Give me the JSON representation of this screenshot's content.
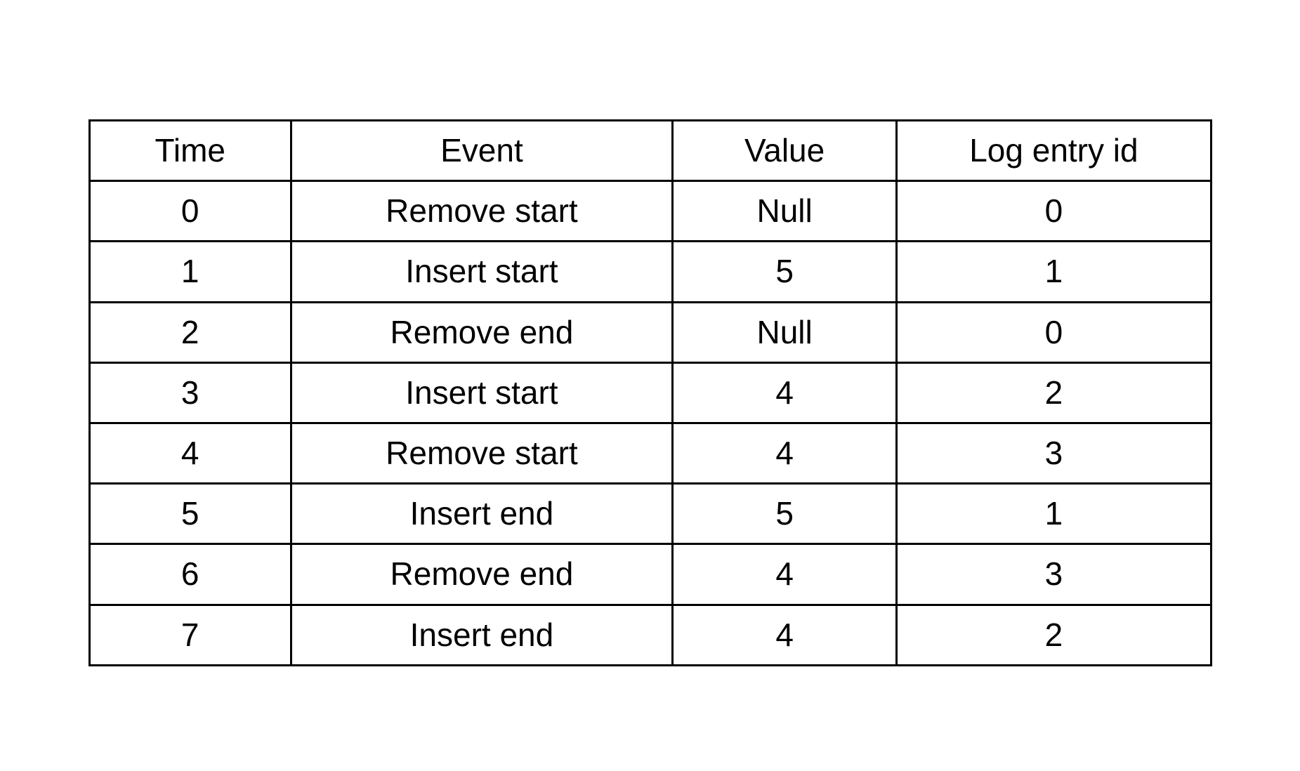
{
  "table": {
    "headers": {
      "time": "Time",
      "event": "Event",
      "value": "Value",
      "log_entry_id": "Log entry id"
    },
    "rows": [
      {
        "time": "0",
        "event": "Remove start",
        "value": "Null",
        "log_entry_id": "0"
      },
      {
        "time": "1",
        "event": "Insert start",
        "value": "5",
        "log_entry_id": "1"
      },
      {
        "time": "2",
        "event": "Remove end",
        "value": "Null",
        "log_entry_id": "0"
      },
      {
        "time": "3",
        "event": "Insert start",
        "value": "4",
        "log_entry_id": "2"
      },
      {
        "time": "4",
        "event": "Remove start",
        "value": "4",
        "log_entry_id": "3"
      },
      {
        "time": "5",
        "event": "Insert end",
        "value": "5",
        "log_entry_id": "1"
      },
      {
        "time": "6",
        "event": "Remove end",
        "value": "4",
        "log_entry_id": "3"
      },
      {
        "time": "7",
        "event": "Insert end",
        "value": "4",
        "log_entry_id": "2"
      }
    ]
  }
}
